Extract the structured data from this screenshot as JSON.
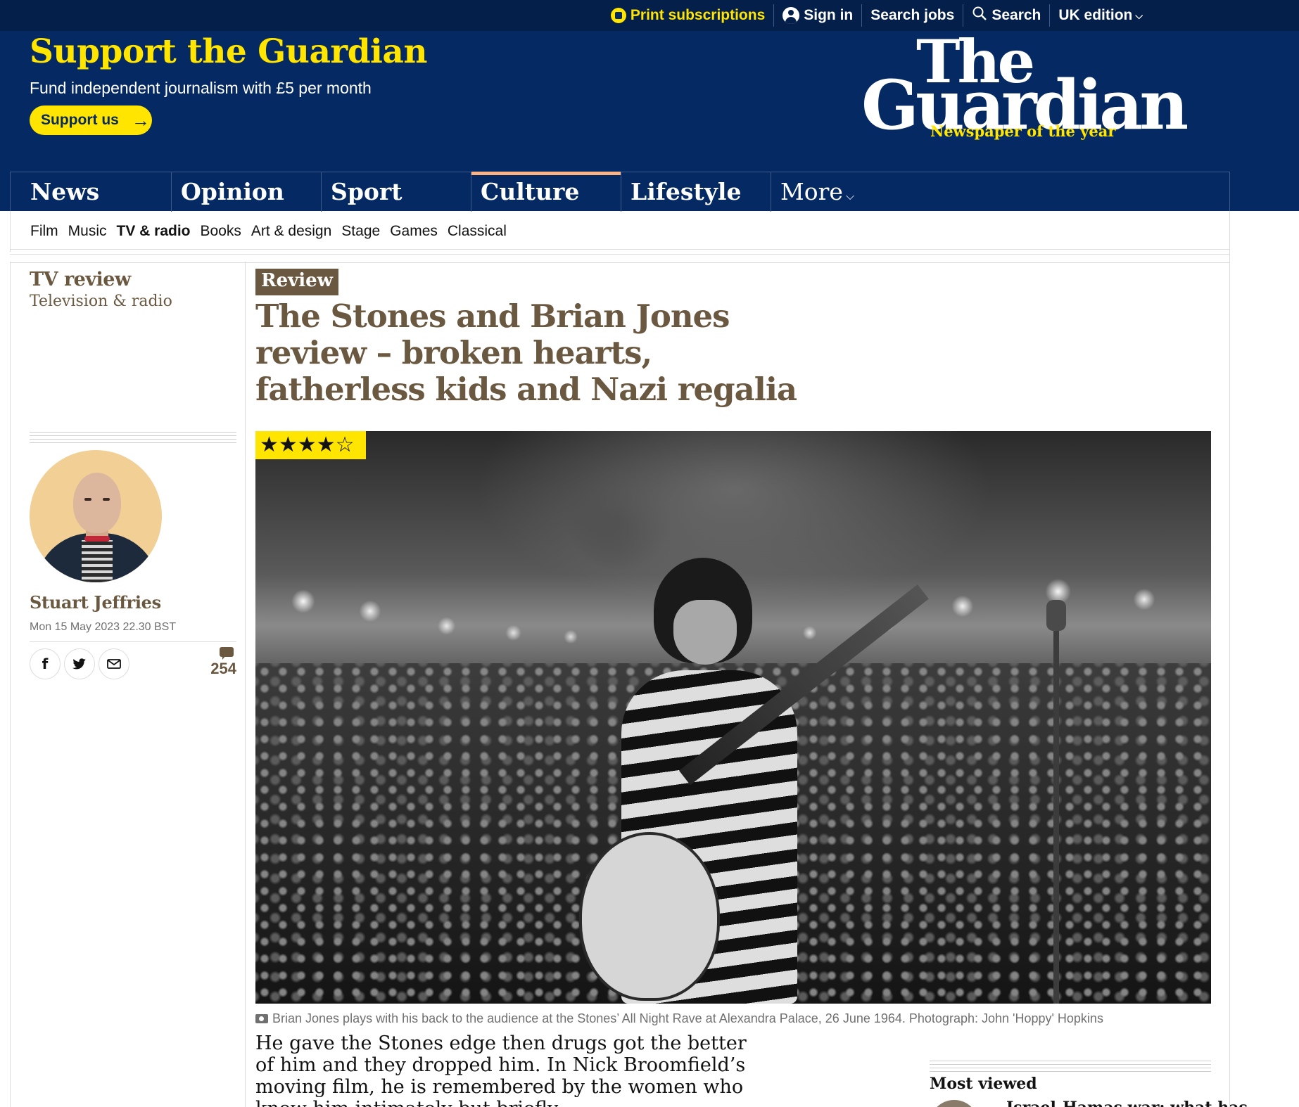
{
  "topbar": {
    "print_subscriptions": "Print subscriptions",
    "sign_in": "Sign in",
    "search_jobs": "Search jobs",
    "search": "Search",
    "edition": "UK edition"
  },
  "support": {
    "title": "Support the Guardian",
    "subtitle": "Fund independent journalism with £5 per month",
    "button": "Support us"
  },
  "logo": {
    "the": "The",
    "guardian": "Guardian",
    "tagline": "Newspaper of the year"
  },
  "pillars": [
    {
      "label": "News"
    },
    {
      "label": "Opinion"
    },
    {
      "label": "Sport"
    },
    {
      "label": "Culture",
      "active": true
    },
    {
      "label": "Lifestyle"
    },
    {
      "label": "More"
    }
  ],
  "subnav": [
    "Film",
    "Music",
    "TV & radio",
    "Books",
    "Art & design",
    "Stage",
    "Games",
    "Classical"
  ],
  "subnav_active": "TV & radio",
  "article": {
    "series": "TV review",
    "section": "Television & radio",
    "kicker": "Review",
    "headline": "The Stones and Brian Jones review – broken hearts, fatherless kids and Nazi regalia",
    "rating": 4,
    "rating_max": 5,
    "stars_text": "★★★★☆",
    "author": "Stuart Jeffries",
    "date": "Mon 15 May 2023 22.30 BST",
    "comment_count": "254",
    "caption": "Brian Jones plays with his back to the audience at the Stones’ All Night Rave at Alexandra Palace, 26 June 1964. Photograph: John 'Hoppy' Hopkins",
    "standfirst": "He gave the Stones edge then drugs got the better of him and they dropped him. In Nick Broomfield’s moving film, he is remembered by the women who knew him intimately but briefly"
  },
  "most_viewed": {
    "title": "Most viewed",
    "first_item": "Israel-Hamas war: what has"
  },
  "colors": {
    "brand_blue": "#052962",
    "topbar_blue": "#041f4a",
    "accent_yellow": "#ffe500",
    "culture_accent": "#6b5840"
  }
}
